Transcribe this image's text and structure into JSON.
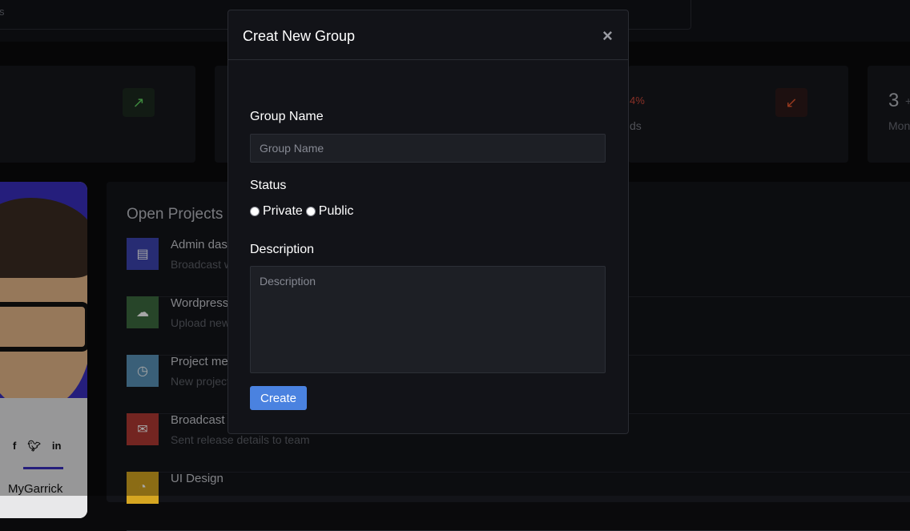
{
  "background": {
    "search_text": "s",
    "stats": {
      "stat3_percent": "4%",
      "stat3_label": "ds",
      "stat4_value": "3",
      "stat4_plus": "+",
      "stat4_label": "Mon"
    },
    "profile": {
      "name": "MyGarrick",
      "social_icons": [
        "facebook-icon",
        "twitter-icon",
        "linkedin-icon"
      ]
    },
    "projects": {
      "title": "Open Projects",
      "rows": [
        {
          "name": "Admin das",
          "sub": "Broadcast w",
          "color": "#3c44b1",
          "icon": "document-icon"
        },
        {
          "name": "Wordpress",
          "sub": "Upload new",
          "color": "#3d6b3f",
          "icon": "cloud-upload-icon"
        },
        {
          "name": "Project me",
          "sub": "New project",
          "color": "#5a92b8",
          "icon": "clock-icon"
        },
        {
          "name": "Broadcast",
          "sub": "Sent release details to team",
          "color": "#b13a33",
          "icon": "envelope-icon"
        },
        {
          "name": "UI Design",
          "sub": "",
          "color": "#d6a621",
          "icon": "pie-chart-icon"
        }
      ]
    }
  },
  "modal": {
    "title": "Creat New Group",
    "close_glyph": "×",
    "group_name_label": "Group Name",
    "group_name_placeholder": "Group Name",
    "group_name_value": "",
    "status_label": "Status",
    "status_options": [
      "Private",
      "Public"
    ],
    "description_label": "Description",
    "description_placeholder": "Description",
    "description_value": "",
    "create_label": "Create"
  },
  "colors": {
    "accent": "#4a82e0",
    "modal_bg": "#121318",
    "input_bg": "#1d1f25"
  }
}
